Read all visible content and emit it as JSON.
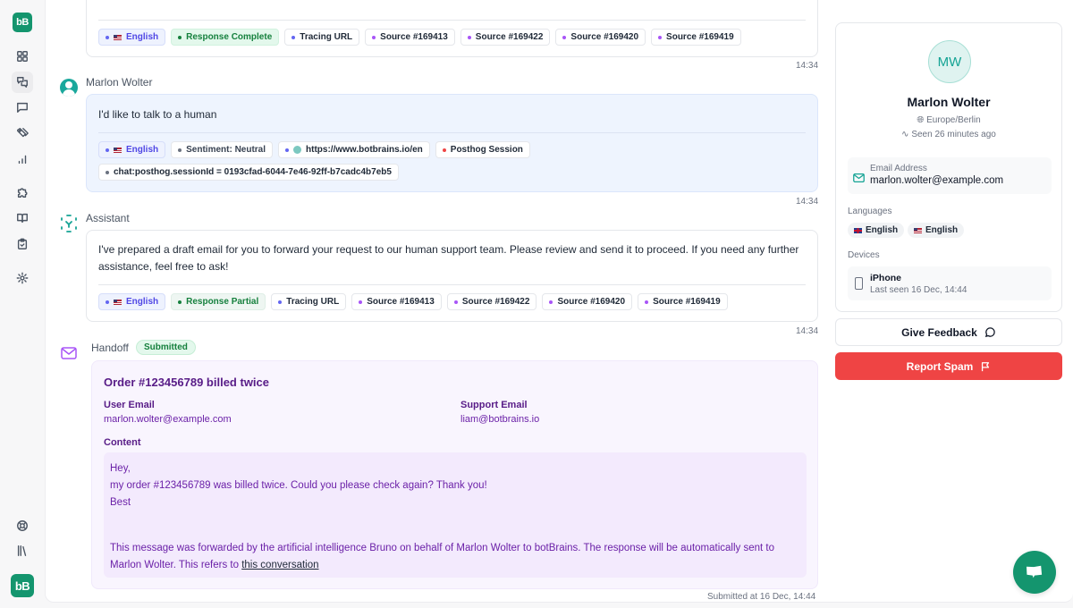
{
  "sidebar": {
    "logo_text": "bB",
    "items": [
      {
        "name": "dashboard",
        "icon": "grid-icon"
      },
      {
        "name": "conversations",
        "icon": "chats-icon",
        "active": true
      },
      {
        "name": "messages",
        "icon": "message-square-icon"
      },
      {
        "name": "tags",
        "icon": "tags-icon"
      },
      {
        "name": "analytics",
        "icon": "bar-chart-icon"
      },
      {
        "name": "integrations",
        "icon": "puzzle-icon"
      },
      {
        "name": "knowledge",
        "icon": "book-open-icon"
      },
      {
        "name": "tasks",
        "icon": "clipboard-check-icon"
      },
      {
        "name": "settings",
        "icon": "gear-icon"
      },
      {
        "name": "support",
        "icon": "lifebuoy-icon"
      },
      {
        "name": "library",
        "icon": "library-icon"
      }
    ]
  },
  "messages": [
    {
      "sender": "",
      "role": "assistant",
      "chips": [
        {
          "type": "lang",
          "label": "English",
          "flag": "us"
        },
        {
          "type": "ok",
          "label": "Response Complete"
        },
        {
          "type": "link",
          "label": "Tracing URL"
        },
        {
          "type": "source",
          "label": "Source #169413"
        },
        {
          "type": "source",
          "label": "Source #169422"
        },
        {
          "type": "source",
          "label": "Source #169420"
        },
        {
          "type": "source",
          "label": "Source #169419"
        }
      ],
      "time": "14:34"
    },
    {
      "sender": "Marlon Wolter",
      "role": "user",
      "text": "I'd like to talk to a human",
      "chips": [
        {
          "type": "lang",
          "label": "English",
          "flag": "us"
        },
        {
          "type": "neutral",
          "label": "Sentiment: Neutral"
        },
        {
          "type": "url",
          "label": "https://www.botbrains.io/en"
        },
        {
          "type": "posthog",
          "label": "Posthog Session"
        },
        {
          "type": "neutral",
          "label": "chat:posthog.sessionId = 0193cfad-6044-7e46-92ff-b7cadc4b7eb5"
        }
      ],
      "time": "14:34"
    },
    {
      "sender": "Assistant",
      "role": "assistant",
      "text": "I've prepared a draft email for you to forward your request to our human support team. Please review and send it to proceed. If you need any further assistance, feel free to ask!",
      "chips": [
        {
          "type": "lang",
          "label": "English",
          "flag": "us"
        },
        {
          "type": "partial",
          "label": "Response Partial"
        },
        {
          "type": "link",
          "label": "Tracing URL"
        },
        {
          "type": "source",
          "label": "Source #169413"
        },
        {
          "type": "source",
          "label": "Source #169422"
        },
        {
          "type": "source",
          "label": "Source #169420"
        },
        {
          "type": "source",
          "label": "Source #169419"
        }
      ],
      "time": "14:34"
    }
  ],
  "handoff": {
    "label": "Handoff",
    "status": "Submitted",
    "title": "Order #123456789 billed twice",
    "user_email_label": "User Email",
    "user_email": "marlon.wolter@example.com",
    "support_email_label": "Support Email",
    "support_email": "liam@botbrains.io",
    "content_label": "Content",
    "content_lines": [
      "Hey,",
      "my order #123456789 was billed twice. Could you please check again? Thank you!",
      "Best"
    ],
    "footer_text": "This message was forwarded by the artificial intelligence Bruno on behalf of Marlon Wolter to botBrains. The response will be automatically sent to Marlon Wolter. This refers to ",
    "footer_link": "this conversation",
    "submitted_at": "Submitted at 16 Dec, 14:44"
  },
  "profile": {
    "initials": "MW",
    "name": "Marlon Wolter",
    "timezone": "Europe/Berlin",
    "seen": "Seen 26 minutes ago",
    "email_label": "Email Address",
    "email": "marlon.wolter@example.com",
    "languages_label": "Languages",
    "languages": [
      {
        "label": "English",
        "flag": "uk"
      },
      {
        "label": "English",
        "flag": "us"
      }
    ],
    "devices_label": "Devices",
    "device_name": "iPhone",
    "device_seen": "Last seen 16 Dec, 14:44"
  },
  "actions": {
    "feedback_label": "Give Feedback",
    "spam_label": "Report Spam"
  },
  "colors": {
    "brand": "#14956e",
    "danger": "#ef4444",
    "handoff_purple": "#6b21a8",
    "source_dot": "#a855f7",
    "link_dot": "#6366f1",
    "posthog_dot": "#ef4444"
  }
}
